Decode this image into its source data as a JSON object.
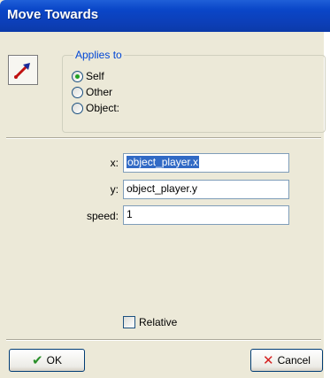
{
  "window": {
    "title": "Move Towards"
  },
  "action_icon": {
    "name": "move-towards-arrow-icon"
  },
  "applies_to": {
    "title": "Applies to",
    "options": [
      {
        "label": "Self",
        "checked": true
      },
      {
        "label": "Other",
        "checked": false
      },
      {
        "label": "Object:",
        "checked": false
      }
    ]
  },
  "fields": {
    "x": {
      "label": "x:",
      "value": "object_player.x"
    },
    "y": {
      "label": "y:",
      "value": "object_player.y"
    },
    "speed": {
      "label": "speed:",
      "value": "1"
    }
  },
  "relative": {
    "label": "Relative",
    "checked": false
  },
  "buttons": {
    "ok": "OK",
    "cancel": "Cancel"
  },
  "colors": {
    "title_bar": "#0a46c8",
    "group_title": "#0046d5",
    "selection": "#316ac5"
  }
}
